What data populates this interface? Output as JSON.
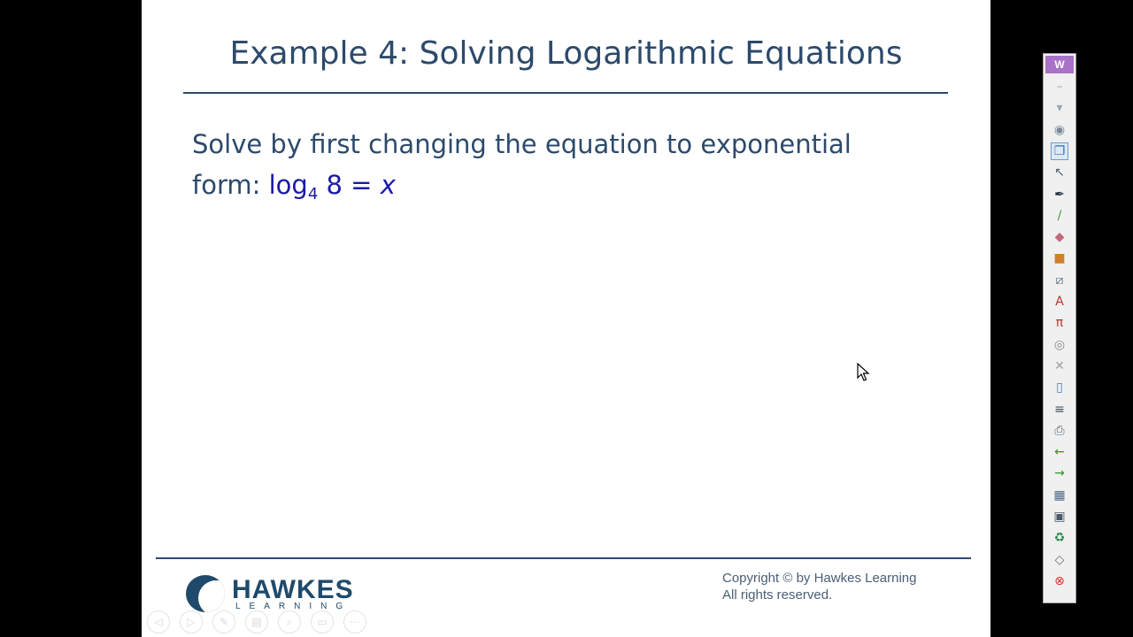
{
  "slide": {
    "title": "Example 4: Solving Logarithmic Equations",
    "instruction_line1": "Solve by first changing the equation to exponential",
    "instruction_line2": "form:",
    "equation": {
      "log": "log",
      "base": "4",
      "argument": "8",
      "equals": "=",
      "variable": "x"
    }
  },
  "footer": {
    "logo_name": "HAWKES",
    "logo_sub": "LEARNING",
    "copyright_line1": "Copyright © by Hawkes Learning",
    "copyright_line2": "All rights reserved."
  },
  "nav_controls": [
    {
      "name": "previous-slide",
      "glyph": "◁"
    },
    {
      "name": "next-slide",
      "glyph": "▷"
    },
    {
      "name": "pen",
      "glyph": "✎"
    },
    {
      "name": "slides-view",
      "glyph": "▤"
    },
    {
      "name": "zoom",
      "glyph": "⌕"
    },
    {
      "name": "screen",
      "glyph": "▭"
    },
    {
      "name": "more-options",
      "glyph": "⋯"
    }
  ],
  "toolbar": {
    "header": "W",
    "tools": [
      {
        "name": "minimize-tool",
        "glyph": "–",
        "color": "#9aa8b8"
      },
      {
        "name": "chevron-tool",
        "glyph": "▾",
        "color": "#9aa8b8"
      },
      {
        "name": "mouse-tool",
        "glyph": "◉",
        "color": "#7a8a9a"
      },
      {
        "name": "copy-slides-tool",
        "glyph": "❐",
        "color": "#3a6ea8"
      },
      {
        "name": "pointer-tool",
        "glyph": "↖",
        "color": "#506070"
      },
      {
        "name": "pen-tool",
        "glyph": "✒",
        "color": "#203040"
      },
      {
        "name": "highlighter-tool",
        "glyph": "/",
        "color": "#3aa030"
      },
      {
        "name": "eraser-tool",
        "glyph": "◆",
        "color": "#c06a7a"
      },
      {
        "name": "shapes-tool",
        "glyph": "■",
        "color": "#d0802a"
      },
      {
        "name": "line-tool",
        "glyph": "⧄",
        "color": "#5a6a7a"
      },
      {
        "name": "text-tool",
        "glyph": "A",
        "color": "#c03030"
      },
      {
        "name": "equation-tool",
        "glyph": "π",
        "color": "#c03030"
      },
      {
        "name": "screenshot-tool",
        "glyph": "◎",
        "color": "#8a8a8a"
      },
      {
        "name": "clear-tool",
        "glyph": "✕",
        "color": "#a0a0a0"
      },
      {
        "name": "page-tool",
        "glyph": "▯",
        "color": "#4a7ab0"
      },
      {
        "name": "layout-tool",
        "glyph": "≡",
        "color": "#405060"
      },
      {
        "name": "print-tool",
        "glyph": "⎙",
        "color": "#5a6a7a"
      },
      {
        "name": "back-arrow-tool",
        "glyph": "←",
        "color": "#2a9a2a"
      },
      {
        "name": "forward-arrow-tool",
        "glyph": "→",
        "color": "#2a9a2a"
      },
      {
        "name": "table-tool",
        "glyph": "▦",
        "color": "#4a6a8a"
      },
      {
        "name": "save-tool",
        "glyph": "▣",
        "color": "#4a5a6a"
      },
      {
        "name": "recycle-tool",
        "glyph": "♻",
        "color": "#2a8a4a"
      },
      {
        "name": "tag-tool",
        "glyph": "◇",
        "color": "#6a6a6a"
      },
      {
        "name": "close-tool",
        "glyph": "⊗",
        "color": "#d83030"
      }
    ]
  }
}
